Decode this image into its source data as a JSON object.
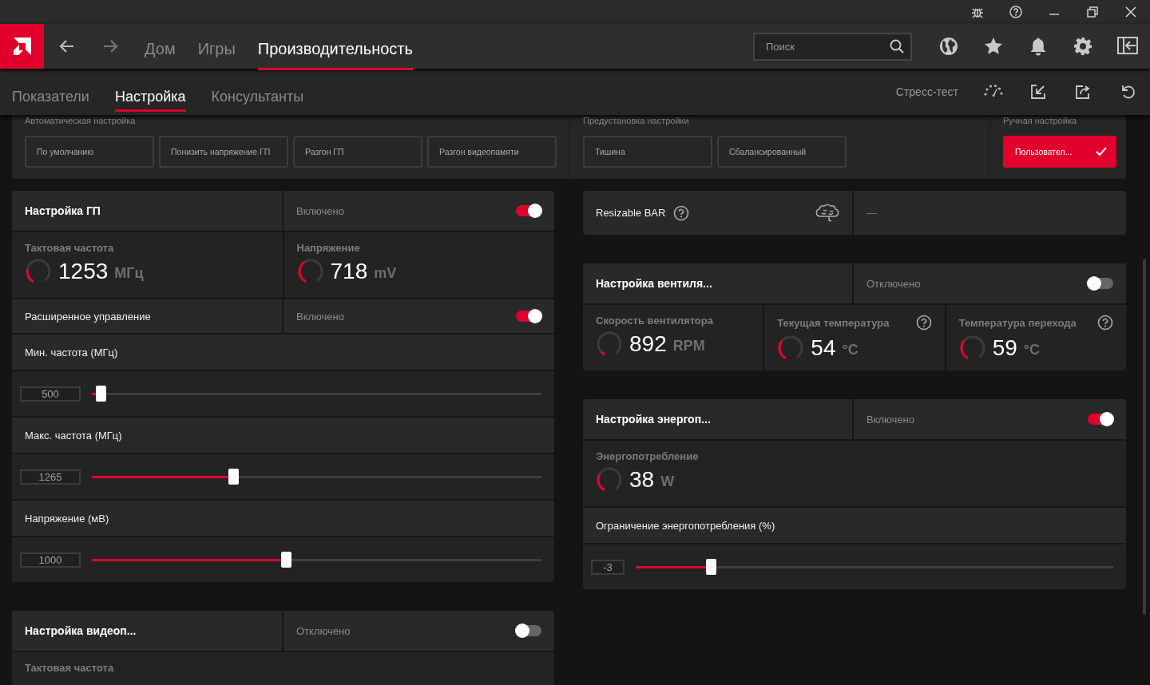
{
  "nav": {
    "tabs": [
      {
        "label": "Дом",
        "selected": false
      },
      {
        "label": "Игры",
        "selected": false
      },
      {
        "label": "Производительность",
        "selected": true
      }
    ],
    "search": {
      "placeholder": "Поиск"
    }
  },
  "subnav": {
    "tabs": [
      {
        "label": "Показатели",
        "selected": false
      },
      {
        "label": "Настройка",
        "selected": true
      },
      {
        "label": "Консультанты",
        "selected": false
      }
    ],
    "stress_test": "Стресс-тест"
  },
  "presets": [
    {
      "title": "Автоматическая настройка",
      "buttons": [
        {
          "label": "По умолчанию",
          "selected": false
        },
        {
          "label": "Понизить напряжение ГП",
          "selected": false
        },
        {
          "label": "Разгон ГП",
          "selected": false
        },
        {
          "label": "Разгон видеопамяти",
          "selected": false
        }
      ]
    },
    {
      "title": "Предустановка настройки",
      "buttons": [
        {
          "label": "Тишина",
          "selected": false
        },
        {
          "label": "Сбалансированный",
          "selected": false
        }
      ]
    },
    {
      "title": "Ручная настройка",
      "buttons": [
        {
          "label": "Пользовател...",
          "selected": true
        }
      ]
    }
  ],
  "left_column": [
    {
      "kind": "tuning",
      "title": "Настройка ГП",
      "status": "Включено",
      "on": true,
      "metrics": [
        {
          "label": "Тактовая частота",
          "value": "1253",
          "unit": "МГц",
          "level": 0.25,
          "help": false
        },
        {
          "label": "Напряжение",
          "value": "718",
          "unit": "mV",
          "level": 0.4,
          "help": false
        }
      ],
      "advanced": {
        "label": "Расширенное управление",
        "status": "Включено",
        "on": true
      },
      "sliders": [
        {
          "label": "Мин. частота (МГц)",
          "value": "500",
          "level": 0.01
        },
        {
          "label": "Макс. частота (МГц)",
          "value": "1265",
          "level": 0.31
        },
        {
          "label": "Напряжение (мВ)",
          "value": "1000",
          "level": 0.43
        }
      ]
    },
    {
      "kind": "tuning",
      "title": "Настройка видеоп...",
      "status": "Отключено",
      "on": false,
      "metrics": [
        {
          "label": "Тактовая частота",
          "help": false
        }
      ]
    }
  ],
  "right_column": [
    {
      "kind": "feature",
      "label": "Resizable BAR",
      "status": "—"
    },
    {
      "kind": "tuning",
      "title": "Настройка вентиля...",
      "status": "Отключено",
      "on": false,
      "metrics": [
        {
          "label": "Скорость вентилятора",
          "value": "892",
          "unit": "RPM",
          "level": 0.08,
          "help": false
        },
        {
          "label": "Текущая температура",
          "value": "54",
          "unit": "°C",
          "level": 0.35,
          "help": true
        },
        {
          "label": "Температура перехода",
          "value": "59",
          "unit": "°C",
          "level": 0.35,
          "help": true
        }
      ]
    },
    {
      "kind": "tuning",
      "title": "Настройка энергоп...",
      "status": "Включено",
      "on": true,
      "metrics": [
        {
          "label": "Энергопотребление",
          "value": "38",
          "unit": "W",
          "level": 0.3,
          "help": false
        }
      ],
      "sliders": [
        {
          "label": "Ограничение энергопотребления (%)",
          "value": "-3",
          "level": 0.15
        }
      ]
    }
  ]
}
